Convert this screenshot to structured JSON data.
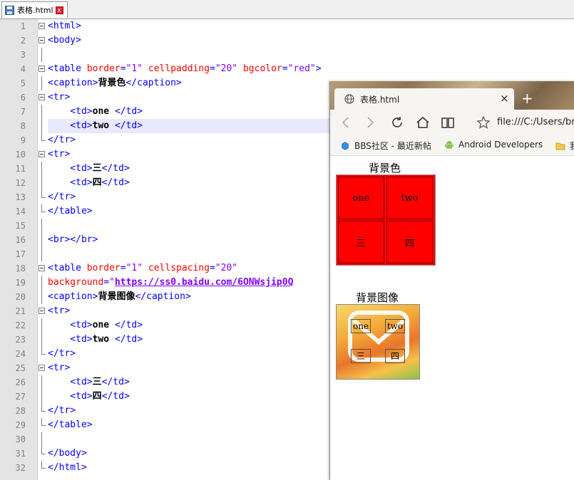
{
  "editor": {
    "tab_name": "表格.html",
    "tab_close": "x",
    "lines": [
      {
        "n": "1",
        "parts": [
          [
            "tag",
            "<html>"
          ]
        ]
      },
      {
        "n": "2",
        "parts": [
          [
            "tag",
            "<body>"
          ]
        ]
      },
      {
        "n": "3",
        "parts": []
      },
      {
        "n": "4",
        "parts": [
          [
            "tag",
            "<table "
          ],
          [
            "attr",
            "border"
          ],
          [
            "tag",
            "="
          ],
          [
            "val",
            "\"1\""
          ],
          [
            "attr",
            " cellpadding"
          ],
          [
            "tag",
            "="
          ],
          [
            "val",
            "\"20\""
          ],
          [
            "attr",
            " bgcolor"
          ],
          [
            "tag",
            "="
          ],
          [
            "val",
            "\"red\""
          ],
          [
            "tag",
            ">"
          ]
        ]
      },
      {
        "n": "5",
        "parts": [
          [
            "tag",
            "<caption>"
          ],
          [
            "txt",
            "背景色"
          ],
          [
            "tag",
            "</caption>"
          ]
        ]
      },
      {
        "n": "6",
        "parts": [
          [
            "tag",
            "<tr>"
          ]
        ]
      },
      {
        "n": "7",
        "parts": [
          [
            "tag",
            "    <td>"
          ],
          [
            "txt",
            "one "
          ],
          [
            "tag",
            "</td>"
          ]
        ]
      },
      {
        "n": "8",
        "parts": [
          [
            "tag",
            "    <td>"
          ],
          [
            "txt",
            "two "
          ],
          [
            "tag",
            "</td>"
          ]
        ]
      },
      {
        "n": "9",
        "parts": [
          [
            "tag",
            "</tr>"
          ]
        ]
      },
      {
        "n": "10",
        "parts": [
          [
            "tag",
            "<tr>"
          ]
        ]
      },
      {
        "n": "11",
        "parts": [
          [
            "tag",
            "    <td>"
          ],
          [
            "txt",
            "三"
          ],
          [
            "tag",
            "</td>"
          ]
        ]
      },
      {
        "n": "12",
        "parts": [
          [
            "tag",
            "    <td>"
          ],
          [
            "txt",
            "四"
          ],
          [
            "tag",
            "</td>"
          ]
        ]
      },
      {
        "n": "13",
        "parts": [
          [
            "tag",
            "</tr>"
          ]
        ]
      },
      {
        "n": "14",
        "parts": [
          [
            "tag",
            "</table>"
          ]
        ]
      },
      {
        "n": "15",
        "parts": []
      },
      {
        "n": "16",
        "parts": [
          [
            "tag",
            "<br></br>"
          ]
        ]
      },
      {
        "n": "17",
        "parts": []
      },
      {
        "n": "18",
        "parts": [
          [
            "tag",
            "<table "
          ],
          [
            "attr",
            "border"
          ],
          [
            "tag",
            "="
          ],
          [
            "val",
            "\"1\""
          ],
          [
            "attr",
            " cellspacing"
          ],
          [
            "tag",
            "="
          ],
          [
            "val",
            "\"20\""
          ]
        ]
      },
      {
        "n": "19",
        "parts": [
          [
            "attr",
            "background"
          ],
          [
            "tag",
            "="
          ],
          [
            "val",
            "\""
          ],
          [
            "url",
            "https://ss0.baidu.com/6ONWsjip0Q"
          ]
        ]
      },
      {
        "n": "20",
        "parts": [
          [
            "tag",
            "<caption>"
          ],
          [
            "txt",
            "背景图像"
          ],
          [
            "tag",
            "</caption>"
          ]
        ]
      },
      {
        "n": "21",
        "parts": [
          [
            "tag",
            "<tr>"
          ]
        ]
      },
      {
        "n": "22",
        "parts": [
          [
            "tag",
            "    <td>"
          ],
          [
            "txt",
            "one "
          ],
          [
            "tag",
            "</td>"
          ]
        ]
      },
      {
        "n": "23",
        "parts": [
          [
            "tag",
            "    <td>"
          ],
          [
            "txt",
            "two "
          ],
          [
            "tag",
            "</td>"
          ]
        ]
      },
      {
        "n": "24",
        "parts": [
          [
            "tag",
            "</tr>"
          ]
        ]
      },
      {
        "n": "25",
        "parts": [
          [
            "tag",
            "<tr>"
          ]
        ]
      },
      {
        "n": "26",
        "parts": [
          [
            "tag",
            "    <td>"
          ],
          [
            "txt",
            "三"
          ],
          [
            "tag",
            "</td>"
          ]
        ]
      },
      {
        "n": "27",
        "parts": [
          [
            "tag",
            "    <td>"
          ],
          [
            "txt",
            "四"
          ],
          [
            "tag",
            "</td>"
          ]
        ]
      },
      {
        "n": "28",
        "parts": [
          [
            "tag",
            "</tr>"
          ]
        ]
      },
      {
        "n": "29",
        "parts": [
          [
            "tag",
            "</table>"
          ]
        ]
      },
      {
        "n": "30",
        "parts": []
      },
      {
        "n": "31",
        "parts": [
          [
            "tag",
            "</body>"
          ]
        ]
      },
      {
        "n": "32",
        "parts": [
          [
            "tag",
            "</html>"
          ]
        ]
      }
    ]
  },
  "browser": {
    "tab_title": "表格.html",
    "tab_close": "×",
    "new_tab": "+",
    "address": "file:///C:/Users/br",
    "bookmarks": [
      "BBS社区 - 最近新帖",
      "Android Developers",
      "我"
    ],
    "table1": {
      "caption": "背景色",
      "bgcolor": "#ff0000",
      "cells": [
        "one",
        "two",
        "三",
        "四"
      ]
    },
    "table2": {
      "caption": "背景图像",
      "cells": [
        "one",
        "two",
        "三",
        "四"
      ]
    }
  }
}
